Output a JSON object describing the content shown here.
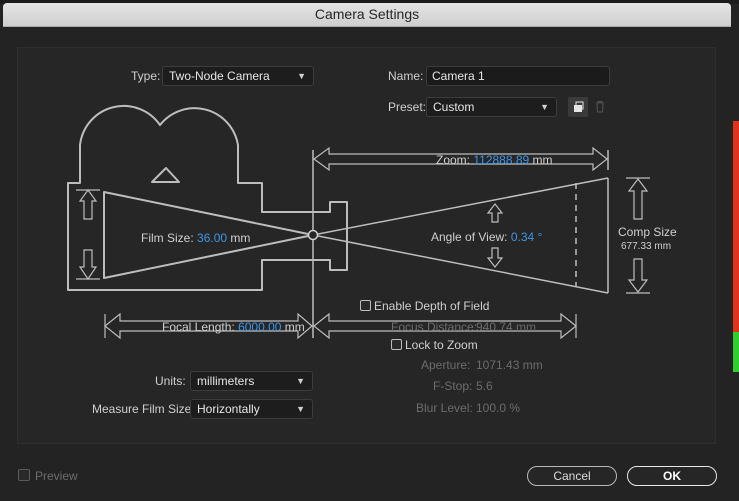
{
  "dialog": {
    "title": "Camera Settings"
  },
  "type": {
    "label": "Type:",
    "value": "Two-Node Camera"
  },
  "name": {
    "label": "Name:",
    "value": "Camera 1"
  },
  "preset": {
    "label": "Preset:",
    "value": "Custom"
  },
  "preset_buttons": {
    "save_icon": "save-preset-icon",
    "delete_icon": "trash-icon"
  },
  "zoom": {
    "label": "Zoom:",
    "value": "112888.89",
    "unit": "mm"
  },
  "film_size": {
    "label": "Film Size:",
    "value": "36.00",
    "unit": "mm"
  },
  "angle_of_view": {
    "label": "Angle of View:",
    "value": "0.34",
    "unit": "°"
  },
  "comp_size": {
    "label": "Comp Size",
    "value": "677.33 mm"
  },
  "focal_length": {
    "label": "Focal Length:",
    "value": "6000.00",
    "unit": "mm"
  },
  "depth_of_field": {
    "enable_label": "Enable Depth of Field",
    "focus_distance_label": "Focus Distance:",
    "focus_distance_value": "940.74 mm",
    "lock_label": "Lock to Zoom",
    "aperture_label": "Aperture:",
    "aperture_value": "1071.43 mm",
    "fstop_label": "F-Stop:",
    "fstop_value": "5.6",
    "blur_label": "Blur Level:",
    "blur_value": "100.0 %"
  },
  "units": {
    "label": "Units:",
    "value": "millimeters"
  },
  "measure_film_size": {
    "label": "Measure Film Size:",
    "value": "Horizontally"
  },
  "preview": {
    "label": "Preview"
  },
  "buttons": {
    "cancel": "Cancel",
    "ok": "OK"
  },
  "colors": {
    "accent": "#3d95e6",
    "side_red": "#e1321e",
    "side_green": "#2ed02e"
  }
}
